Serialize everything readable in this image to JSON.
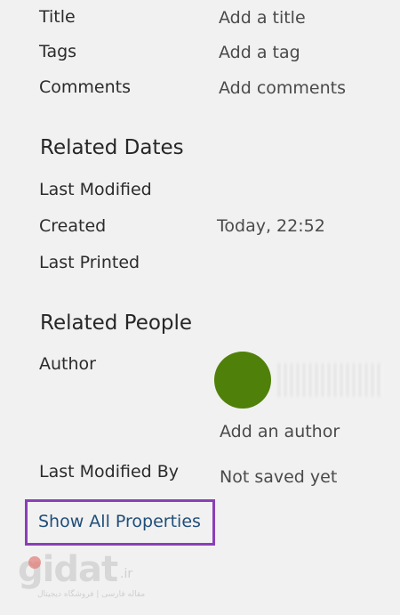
{
  "properties": {
    "title_label": "Title",
    "title_value": "Add a title",
    "tags_label": "Tags",
    "tags_value": "Add a tag",
    "comments_label": "Comments",
    "comments_value": "Add comments"
  },
  "related_dates": {
    "heading": "Related Dates",
    "last_modified_label": "Last Modified",
    "created_label": "Created",
    "created_value": "Today, 22:52",
    "last_printed_label": "Last Printed"
  },
  "related_people": {
    "heading": "Related People",
    "author_label": "Author",
    "add_author": "Add an author",
    "last_modified_by_label": "Last Modified By",
    "last_modified_by_value": "Not saved yet"
  },
  "show_all_properties": "Show All Properties",
  "watermark": {
    "logo": "gidat",
    "suffix": ".ir",
    "tagline": "مقاله فارسی | فروشگاه دیجیتال"
  },
  "colors": {
    "avatar": "#4f8009",
    "highlight_border": "#8a3fb8",
    "link": "#1f4e79"
  }
}
